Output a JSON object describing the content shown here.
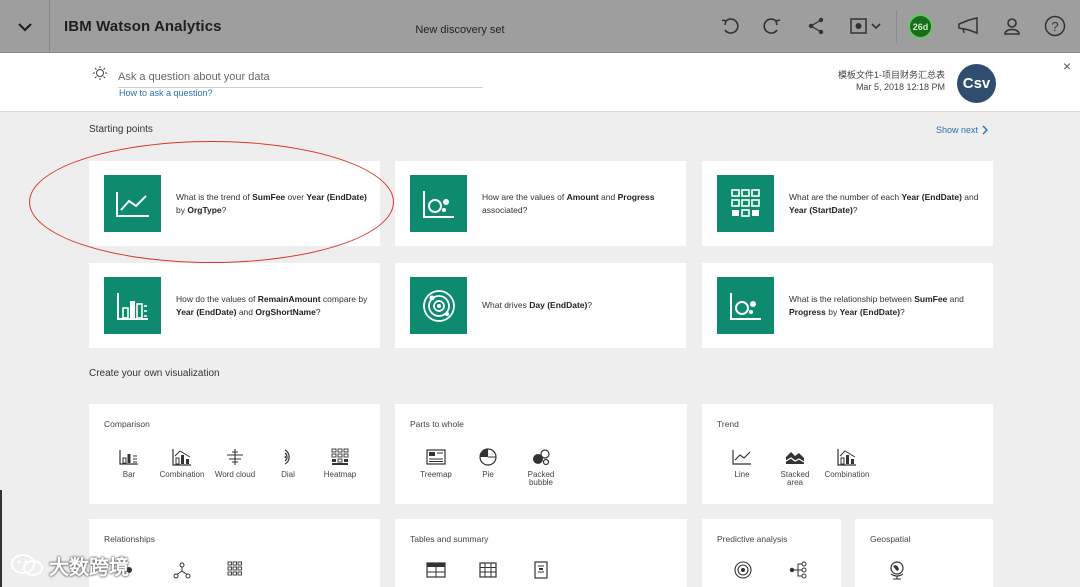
{
  "topbar": {
    "brand": "IBM Watson Analytics",
    "doc_title": "New discovery set",
    "notification_count": "26d",
    "icons": [
      "chevron-down-icon",
      "undo-icon",
      "redo-icon",
      "share-icon",
      "screenshot-icon",
      "notification-badge",
      "megaphone-icon",
      "user-icon",
      "help-icon"
    ]
  },
  "ask": {
    "placeholder": "Ask a question about your data",
    "howto": "How to ask a question?",
    "file_name": "模板文件1-项目财务汇总表",
    "file_date": "Mar 5, 2018 12:18 PM",
    "file_badge": "Csv",
    "close": "×"
  },
  "starting_points": {
    "title": "Starting points",
    "show_next": "Show next",
    "cards": [
      {
        "icon": "line-trend-icon",
        "parts": [
          [
            "What is the trend of ",
            false
          ],
          [
            "SumFee",
            true
          ],
          [
            " over ",
            false
          ],
          [
            "Year (EndDate)",
            true
          ],
          [
            " by ",
            false
          ],
          [
            "OrgType",
            true
          ],
          [
            "?",
            false
          ]
        ]
      },
      {
        "icon": "bubble-scatter-icon",
        "parts": [
          [
            "How are the values of ",
            false
          ],
          [
            "Amount",
            true
          ],
          [
            " and ",
            false
          ],
          [
            "Progress",
            true
          ],
          [
            " associated?",
            false
          ]
        ]
      },
      {
        "icon": "heatmap-grid-icon",
        "parts": [
          [
            "What are the number of each ",
            false
          ],
          [
            "Year (EndDate)",
            true
          ],
          [
            " and ",
            false
          ],
          [
            "Year (StartDate)",
            true
          ],
          [
            "?",
            false
          ]
        ]
      },
      {
        "icon": "bar-compare-icon",
        "parts": [
          [
            "How do the values of ",
            false
          ],
          [
            "RemainAmount",
            true
          ],
          [
            " compare by ",
            false
          ],
          [
            "Year (EndDate)",
            true
          ],
          [
            " and ",
            false
          ],
          [
            "OrgShortName",
            true
          ],
          [
            "?",
            false
          ]
        ]
      },
      {
        "icon": "spiral-drivers-icon",
        "parts": [
          [
            "What drives ",
            false
          ],
          [
            "Day (EndDate)",
            true
          ],
          [
            "?",
            false
          ]
        ]
      },
      {
        "icon": "bubble-scatter-icon",
        "parts": [
          [
            "What is the relationship between ",
            false
          ],
          [
            "SumFee",
            true
          ],
          [
            " and ",
            false
          ],
          [
            "Progress",
            true
          ],
          [
            " by ",
            false
          ],
          [
            "Year (EndDate)",
            true
          ],
          [
            "?",
            false
          ]
        ]
      }
    ]
  },
  "create": {
    "title": "Create your own visualization",
    "groups": [
      {
        "title": "Comparison",
        "items": [
          {
            "label": "Bar",
            "icon": "bar-icon"
          },
          {
            "label": "Combination",
            "icon": "combination-icon"
          },
          {
            "label": "Word cloud",
            "icon": "word-cloud-icon"
          },
          {
            "label": "Dial",
            "icon": "dial-icon"
          },
          {
            "label": "Heatmap",
            "icon": "heatmap-icon"
          }
        ]
      },
      {
        "title": "Parts to whole",
        "items": [
          {
            "label": "Treemap",
            "icon": "treemap-icon"
          },
          {
            "label": "Pie",
            "icon": "pie-icon"
          },
          {
            "label": "Packed bubble",
            "icon": "packed-bubble-icon"
          }
        ]
      },
      {
        "title": "Trend",
        "items": [
          {
            "label": "Line",
            "icon": "line-icon"
          },
          {
            "label": "Stacked area",
            "icon": "stacked-area-icon"
          },
          {
            "label": "Combination",
            "icon": "combination-icon"
          }
        ]
      },
      {
        "title": "Relationships",
        "items": [
          {
            "label": "",
            "icon": "scatter-icon"
          },
          {
            "label": "",
            "icon": "network-icon"
          },
          {
            "label": "",
            "icon": "grid-icon"
          }
        ]
      },
      {
        "title": "Tables and summary",
        "items": [
          {
            "label": "",
            "icon": "list-table-icon"
          },
          {
            "label": "",
            "icon": "crosstab-icon"
          },
          {
            "label": "",
            "icon": "summary-icon"
          }
        ]
      },
      {
        "title": "Predictive analysis",
        "items": [
          {
            "label": "",
            "icon": "spiral-icon"
          },
          {
            "label": "",
            "icon": "decision-tree-icon"
          }
        ]
      },
      {
        "title": "Geospatial",
        "items": [
          {
            "label": "",
            "icon": "globe-icon"
          }
        ]
      }
    ]
  },
  "watermark": "大数跨境",
  "colors": {
    "tile": "#0e8a6e",
    "topbar": "#9e9e9e",
    "link": "#2a6fb0",
    "annotation": "#d9362b",
    "avatar": "#2f4d6e"
  }
}
